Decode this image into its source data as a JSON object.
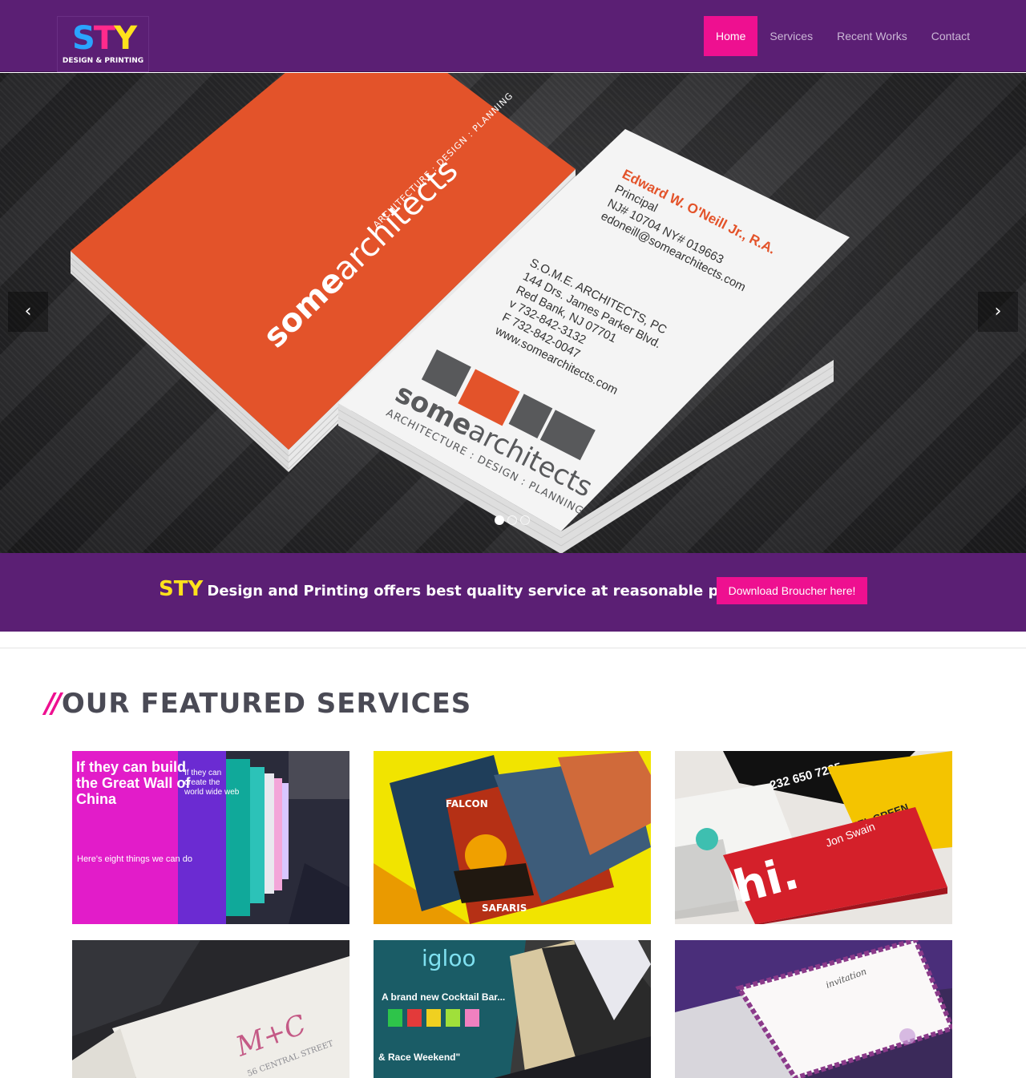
{
  "header": {
    "logo": {
      "mark": "STY",
      "subtitle": "DESIGN & PRINTING"
    },
    "nav": [
      {
        "label": "Home",
        "active": true
      },
      {
        "label": "Services",
        "active": false
      },
      {
        "label": "Recent Works",
        "active": false
      },
      {
        "label": "Contact",
        "active": false
      }
    ]
  },
  "hero": {
    "prev_icon": "chevron-left-icon",
    "next_icon": "chevron-right-icon",
    "slide_count": 3,
    "active_slide": 1,
    "orange_card": {
      "brand_bold": "some",
      "brand_light": "architects",
      "tagline": "ARCHITECTURE : DESIGN : PLANNING"
    },
    "white_card": {
      "name": "Edward W. O'Neill Jr., R.A.",
      "title": "Principal",
      "license": "NJ# 10704 NY# 019663",
      "email": "edoneill@somearchitects.com",
      "company": "S.O.M.E. ARCHITECTS, PC",
      "address1": "144 Drs. James Parker Blvd.",
      "address2": "Red Bank, NJ 07701",
      "phone": "v 732-842-3132",
      "fax": "F 732-842-0047",
      "web": "www.somearchitects.com",
      "brand_bold": "some",
      "brand_light": "architects",
      "tagline": "ARCHITECTURE : DESIGN : PLANNING"
    }
  },
  "promo": {
    "brand": "STY",
    "text": "Design and Printing offers best quality service at reasonable price!",
    "button": "Download Broucher here!"
  },
  "section": {
    "slash": "//",
    "title": "OUR FEATURED SERVICES"
  },
  "tiles": [
    {
      "text1": "If they can build the Great Wall of China",
      "text2": "Here's eight things we can do",
      "text3": "If they can create the world wide web"
    },
    {
      "text1": "FALCON",
      "text2": "SAFARIS"
    },
    {
      "text1": "232 650 7225",
      "text2": "Jon Swain",
      "text3": "hi.",
      "text4": "MEL GREEN"
    },
    {
      "text1": "M+C",
      "text2": "56 CENTRAL STREET"
    },
    {
      "text1": "igloo",
      "text2": "A brand new Cocktail Bar...",
      "text3": "& Race Weekend\""
    },
    {
      "text1": "invitation"
    }
  ],
  "colors": {
    "header_bg": "#5b1f74",
    "accent": "#ee1090",
    "brand_yellow": "#ffe21c",
    "card_orange": "#e3532a"
  }
}
